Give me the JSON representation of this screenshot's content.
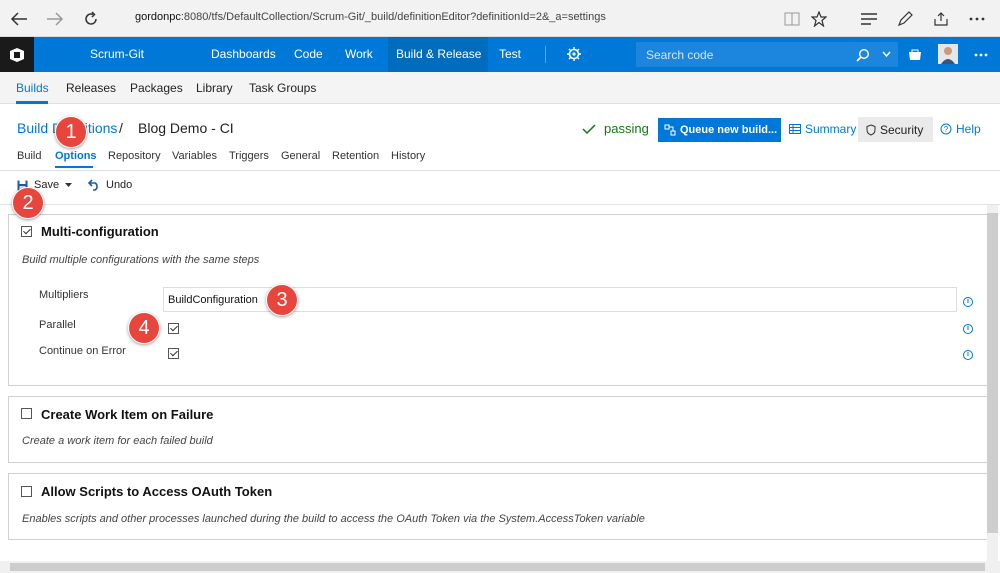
{
  "browser": {
    "url_host": "gordonpc",
    "url_path": ":8080/tfs/DefaultCollection/Scrum-Git/_build/definitionEditor?definitionId=2&_a=settings",
    "back_icon": "arrow-left-icon",
    "forward_icon": "arrow-right-icon",
    "refresh_icon": "refresh-icon",
    "reading_icon": "book-icon",
    "favorite_icon": "star-icon",
    "hub_icon": "hub-lines-icon",
    "notes_icon": "pen-icon",
    "share_icon": "share-icon",
    "more_icon": "ellipsis-icon"
  },
  "header": {
    "project": "Scrum-Git",
    "nav": [
      "Dashboards",
      "Code",
      "Work",
      "Build & Release",
      "Test"
    ],
    "active_nav": "Build & Release",
    "search_placeholder": "Search code",
    "settings_icon": "gear-icon",
    "accent": "#0078d7"
  },
  "subnav": {
    "items": [
      "Builds",
      "Releases",
      "Packages",
      "Library",
      "Task Groups"
    ],
    "active": "Builds"
  },
  "page": {
    "crumb": "Build Definitions",
    "crumb_sep": "/",
    "title": "Blog Demo - CI",
    "status": "passing",
    "queue_label": "Queue new build...",
    "summary_label": "Summary",
    "security_label": "Security",
    "help_label": "Help"
  },
  "def_tabs": {
    "items": [
      "Build",
      "Options",
      "Repository",
      "Variables",
      "Triggers",
      "General",
      "Retention",
      "History"
    ],
    "active": "Options"
  },
  "toolbar": {
    "save_label": "Save",
    "undo_label": "Undo"
  },
  "sections": {
    "multi": {
      "title": "Multi-configuration",
      "checked": true,
      "desc": "Build multiple configurations with the same steps",
      "multipliers_label": "Multipliers",
      "multipliers_value": "BuildConfiguration",
      "parallel_label": "Parallel",
      "parallel_checked": true,
      "continue_label": "Continue on Error",
      "continue_checked": true
    },
    "workitem": {
      "title": "Create Work Item on Failure",
      "checked": false,
      "desc": "Create a work item for each failed build"
    },
    "oauth": {
      "title": "Allow Scripts to Access OAuth Token",
      "checked": false,
      "desc": "Enables scripts and other processes launched during the build to access the OAuth Token via the System.AccessToken variable"
    }
  },
  "callouts": [
    "1",
    "2",
    "3",
    "4"
  ]
}
